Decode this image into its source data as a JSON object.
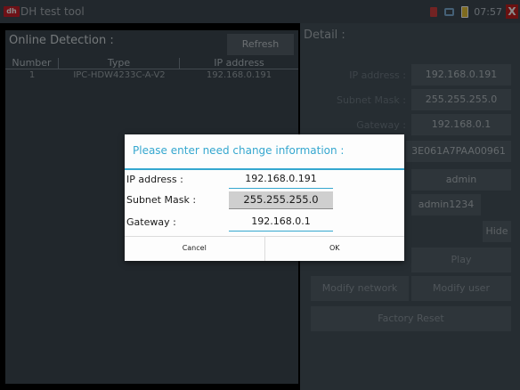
{
  "app": {
    "logo": "dh",
    "title": "DH test tool",
    "time": "07:57",
    "close": "X"
  },
  "left": {
    "title": "Online Detection :",
    "refresh_label": "Refresh",
    "columns": [
      "Number",
      "Type",
      "IP address"
    ],
    "rows": [
      {
        "number": "1",
        "type": "IPC-HDW4233C-A-V2",
        "ip": "192.168.0.191"
      }
    ]
  },
  "detail": {
    "title": "Detail :",
    "ip_label": "IP address :",
    "ip_value": "192.168.0.191",
    "mask_label": "Subnet Mask :",
    "mask_value": "255.255.255.0",
    "gateway_label": "Gateway :",
    "gateway_value": "192.168.0.1",
    "serial_value": "3E061A7PAA00961",
    "username_value": "admin",
    "password_value": "admin1234",
    "hide_label": "Hide",
    "play_label": "Play",
    "modify_network_label": "Modify network",
    "modify_user_label": "Modify user",
    "factory_reset_label": "Factory Reset"
  },
  "dialog": {
    "title": "Please enter need change information  :",
    "ip_label": "IP address :",
    "ip_value": "192.168.0.191",
    "mask_label": "Subnet Mask :",
    "mask_value": "255.255.255.0",
    "gateway_label": "Gateway :",
    "gateway_value": "192.168.0.1",
    "cancel_label": "Cancel",
    "ok_label": "OK"
  },
  "colors": {
    "accent": "#35a7cf",
    "panel_left": "#3c4851",
    "panel_right": "#46525b",
    "close": "#c21f1f"
  }
}
